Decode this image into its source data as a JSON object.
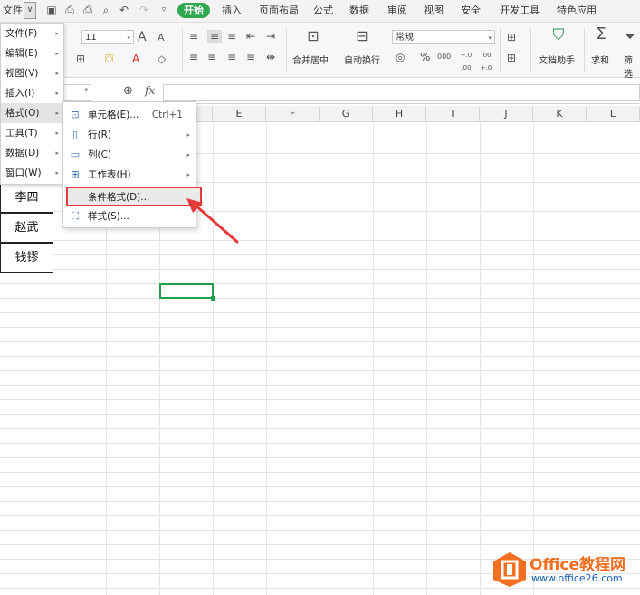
{
  "menubar": {
    "file_label": "文件",
    "tabs": [
      "开始",
      "插入",
      "页面布局",
      "公式",
      "数据",
      "审阅",
      "视图",
      "安全",
      "开发工具",
      "特色应用"
    ]
  },
  "ribbon": {
    "font_size": "11",
    "number_format": "常规",
    "merge_center": "合并居中",
    "auto_wrap": "自动换行",
    "doc_helper": "文档助手",
    "sum_label": "求和",
    "filter_label": "筛选",
    "grow_font": "A",
    "shrink_font": "A",
    "percent": "%",
    "thousands": "000",
    "inc_decimal": "+.0 .00",
    "dec_decimal": ".00 +.0"
  },
  "formula_bar": {
    "fx_label": "fx"
  },
  "columns": [
    "E",
    "F",
    "G",
    "H",
    "I",
    "J",
    "K",
    "L"
  ],
  "cells": [
    "李四",
    "赵武",
    "钱镠"
  ],
  "main_menu": [
    {
      "label": "文件(F)"
    },
    {
      "label": "编辑(E)"
    },
    {
      "label": "视图(V)"
    },
    {
      "label": "插入(I)"
    },
    {
      "label": "格式(O)"
    },
    {
      "label": "工具(T)"
    },
    {
      "label": "数据(D)"
    },
    {
      "label": "窗口(W)"
    }
  ],
  "format_submenu": [
    {
      "label": "单元格(E)...",
      "shortcut": "Ctrl+1"
    },
    {
      "label": "行(R)"
    },
    {
      "label": "列(C)"
    },
    {
      "label": "工作表(H)"
    },
    {
      "label": "条件格式(D)..."
    },
    {
      "label": "样式(S)..."
    }
  ],
  "logo": {
    "brand": "Office教程网",
    "url_text": "www.office26.com"
  },
  "colors": {
    "accent_green": "#2fa84f",
    "highlight_red": "#e53b3b",
    "logo_orange": "#f36f21"
  }
}
